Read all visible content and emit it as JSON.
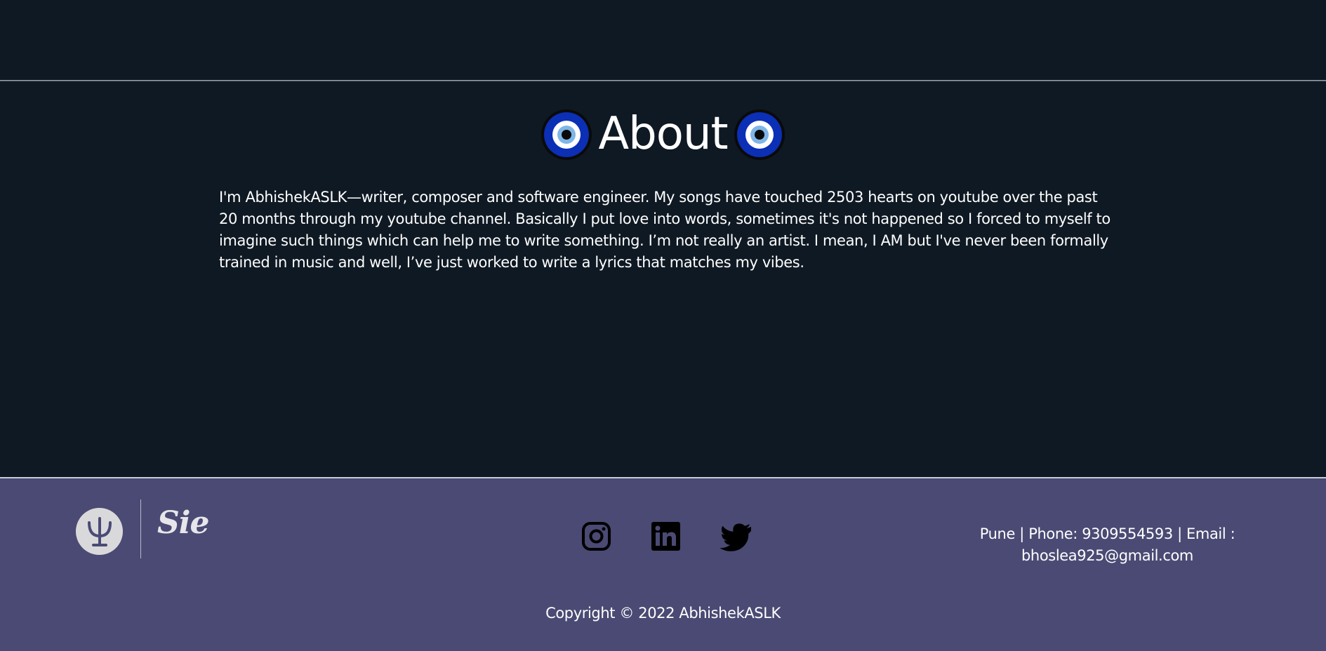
{
  "about": {
    "title": "About",
    "paragraph": "I'm AbhishekASLK—writer, composer and software engineer. My songs have touched 2503 hearts on youtube over the past 20 months through my youtube channel. Basically I put love into words, sometimes it's not happened so I forced to myself to imagine such things which can help me to write something. I’m not really an artist. I mean, I AM but I've never been formally trained in music and well, I’ve just worked to write a lyrics that matches my vibes.",
    "icon": "evil-eye-icon"
  },
  "footer": {
    "logo_text": "Sie",
    "logo_icon": "psi-icon",
    "social": [
      {
        "name": "instagram-icon"
      },
      {
        "name": "linkedin-icon"
      },
      {
        "name": "twitter-icon"
      }
    ],
    "contact_line1": "Pune | Phone: 9309554593 | Email :",
    "contact_line2": "bhoslea925@gmail.com",
    "copyright": "Copyright © 2022 AbhishekASLK"
  },
  "colors": {
    "background": "#0f1923",
    "footer_background": "#4a4a74",
    "eye_outer": "#0b2fb5",
    "eye_mid": "#ffffff",
    "eye_inner": "#7fb6e8",
    "eye_pupil": "#0a0a0a"
  }
}
